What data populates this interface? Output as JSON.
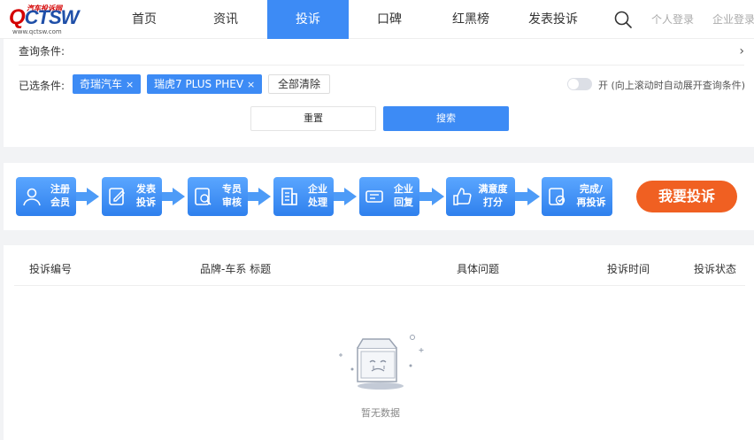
{
  "logo": {
    "top_text": "汽车投诉网",
    "q": "Q",
    "rest": "CTSW",
    "url": "www.qctsw.com"
  },
  "nav": {
    "items": [
      {
        "label": "首页",
        "active": false
      },
      {
        "label": "资讯",
        "active": false
      },
      {
        "label": "投诉",
        "active": true
      },
      {
        "label": "口碑",
        "active": false
      },
      {
        "label": "红黑榜",
        "active": false
      },
      {
        "label": "发表投诉",
        "active": false
      }
    ],
    "personal_login": "个人登录",
    "company_login": "企业登录"
  },
  "filter": {
    "query_label": "查询条件:",
    "chevron": "›",
    "selected_label": "已选条件:",
    "tags": [
      {
        "label": "奇瑞汽车",
        "remove": "×"
      },
      {
        "label": "瑞虎7 PLUS PHEV",
        "remove": "×"
      }
    ],
    "clear_all": "全部清除",
    "toggle_text": "开 (向上滚动时自动展开查询条件)",
    "reset": "重置",
    "search": "搜索"
  },
  "steps": [
    {
      "line1": "注册",
      "line2": "会员",
      "icon": "user-icon"
    },
    {
      "line1": "发表",
      "line2": "投诉",
      "icon": "edit-icon"
    },
    {
      "line1": "专员",
      "line2": "审核",
      "icon": "review-icon"
    },
    {
      "line1": "企业",
      "line2": "处理",
      "icon": "building-icon"
    },
    {
      "line1": "企业",
      "line2": "回复",
      "icon": "reply-icon"
    },
    {
      "line1": "满意度",
      "line2": "打分",
      "icon": "thumbs-up-icon"
    },
    {
      "line1": "完成/",
      "line2": "再投诉",
      "icon": "done-icon"
    }
  ],
  "complain_button": "我要投诉",
  "table": {
    "headers": [
      "投诉编号",
      "品牌-车系 标题",
      "具体问题",
      "投诉时间",
      "投诉状态"
    ],
    "empty_text": "暂无数据"
  },
  "colors": {
    "accent": "#3d8bf5",
    "cta": "#f06022",
    "brand_red": "#d40000",
    "brand_blue": "#1f4fa8"
  }
}
